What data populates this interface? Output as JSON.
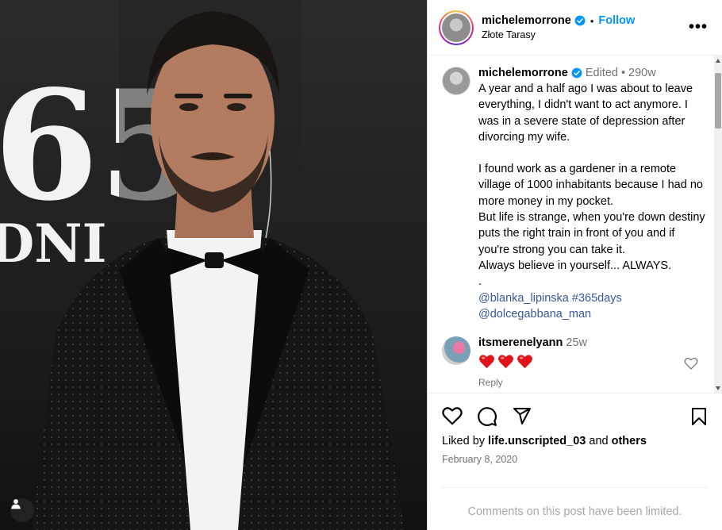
{
  "post": {
    "username": "michelemorrone",
    "follow_label": "Follow",
    "location": "Złote Tarasy",
    "more_label": "•••"
  },
  "photo": {
    "backdrop_text_large": "65",
    "backdrop_text_small": "DNI"
  },
  "caption": {
    "username": "michelemorrone",
    "edited_label": "Edited",
    "time": "290w",
    "paragraphs": [
      "A year and a half ago I was about to leave everything, I didn't want to act anymore. I was in a severe state of depression after divorcing my wife.",
      "I found work as a gardener in a remote village of 1000 inhabitants because I had no more money in my pocket.",
      "But life is strange, when you're down destiny puts the right train in front of you and if you're strong you can take it.",
      "Always believe in yourself... ALWAYS.",
      "."
    ],
    "mention_line_1": "@blanka_lipinska #365days",
    "mention_line_2": "@dolcegabbana_man"
  },
  "comment": {
    "username": "itsmerenelyann",
    "time": "25w",
    "reply_label": "Reply"
  },
  "footer": {
    "liked_by_prefix": "Liked by",
    "liked_by_user": "life.unscripted_03",
    "liked_by_and": "and",
    "liked_by_others": "others",
    "date": "February 8, 2020",
    "comments_limited": "Comments on this post have been limited."
  },
  "colors": {
    "follow_blue": "#0095f6",
    "link_blue": "#385898",
    "verified_blue": "#0095f6",
    "heart_red": "#e0131a"
  },
  "icons": [
    "user-tag-icon",
    "verified-icon",
    "more-icon",
    "heart-icon",
    "comment-icon",
    "share-icon",
    "bookmark-icon"
  ]
}
